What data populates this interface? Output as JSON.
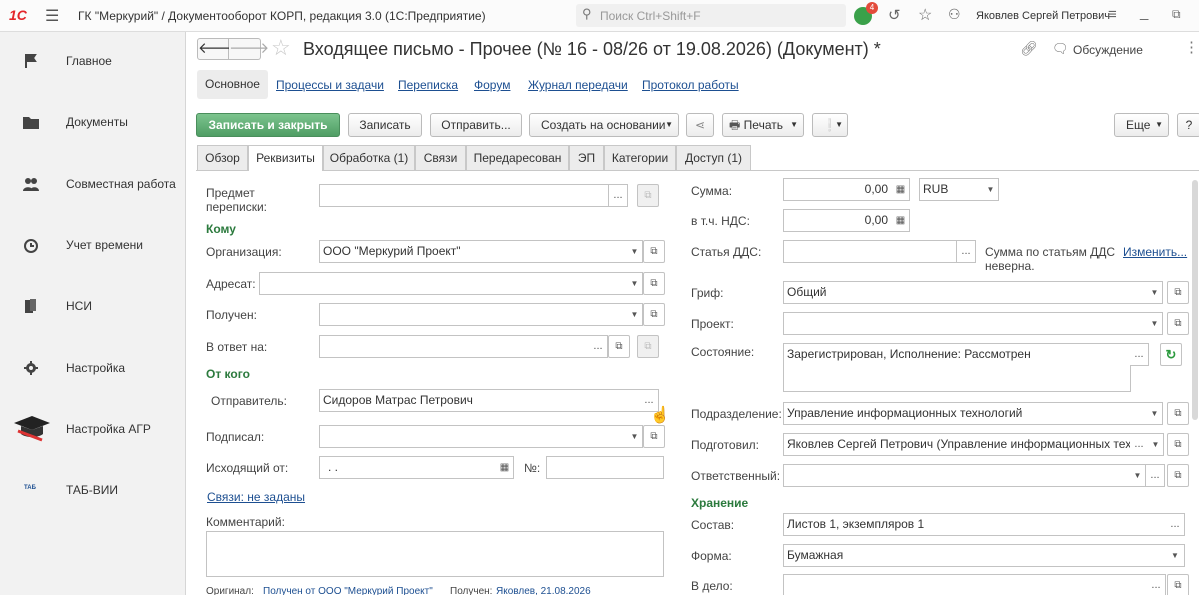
{
  "app": {
    "title": "ГК \"Меркурий\" / Документооборот КОРП, редакция 3.0  (1С:Предприятие)",
    "search_placeholder": "Поиск Ctrl+Shift+F",
    "notif_count": "4",
    "user": "Яковлев Сергей Петрович"
  },
  "sidebar": {
    "items": [
      {
        "label": "Главное",
        "icon": "flag-icon"
      },
      {
        "label": "Документы",
        "icon": "folder-icon"
      },
      {
        "label": "Совместная работа",
        "icon": "people-icon"
      },
      {
        "label": "Учет времени",
        "icon": "clock-icon"
      },
      {
        "label": "НСИ",
        "icon": "book-icon"
      },
      {
        "label": "Настройка",
        "icon": "gear-icon"
      },
      {
        "label": "Настройка АГР",
        "icon": "graduation-cap-icon"
      },
      {
        "label": "ТАБ-ВИИ",
        "icon": "tab-logo-icon",
        "logo_text": "ТАБ"
      }
    ]
  },
  "doc": {
    "title": "Входящее письмо - Прочее (№ 16 - 08/26 от 19.08.2026) (Документ) *",
    "discussion": "Обсуждение"
  },
  "nav": {
    "main": "Основное",
    "links": [
      "Процессы и задачи",
      "Переписка",
      "Форум",
      "Журнал передачи",
      "Протокол работы"
    ]
  },
  "toolbar": {
    "save_close": "Записать и закрыть",
    "save": "Записать",
    "send": "Отправить...",
    "create_basis": "Создать на основании",
    "print": "Печать",
    "more": "Еще",
    "help": "?"
  },
  "tabs": [
    "Обзор",
    "Реквизиты",
    "Обработка (1)",
    "Связи",
    "Передаресован",
    "ЭП",
    "Категории",
    "Доступ (1)"
  ],
  "left": {
    "subject_label1": "Предмет",
    "subject_label2": "переписки:",
    "subject_value": "",
    "to_group": "Кому",
    "org_label": "Организация:",
    "org_value": "ООО \"Меркурий Проект\"",
    "addressee_label": "Адресат:",
    "addressee_value": "",
    "received_label": "Получен:",
    "received_value": "",
    "reply_label": "В ответ на:",
    "reply_value": "",
    "from_group": "От кого",
    "sender_label": "Отправитель:",
    "sender_value": "Сидоров Матрас Петрович",
    "signed_label": "Подписал:",
    "signed_value": "",
    "outgoing_label": "Исходящий от:",
    "outgoing_value": "  .  .",
    "number_label": "№:",
    "number_value": "",
    "links_text": "Связи: не заданы",
    "comment_label": "Комментарий:",
    "comment_value": "",
    "original_label": "Оригинал:",
    "original_value": "Получен от ООО \"Меркурий Проект\"",
    "received_by_label": "Получен:",
    "received_by_value": "Яковлев, 21.08.2026"
  },
  "right": {
    "sum_label": "Сумма:",
    "sum_value": "0,00",
    "currency": "RUB",
    "vat_label": "в т.ч. НДС:",
    "vat_value": "0,00",
    "dds_label": "Статья ДДС:",
    "dds_value": "",
    "dds_note1": "Сумма по статьям ДДС",
    "dds_note2": "неверна.",
    "dds_change": "Изменить...",
    "grif_label": "Гриф:",
    "grif_value": "Общий",
    "project_label": "Проект:",
    "project_value": "",
    "state_label": "Состояние:",
    "state_value": "Зарегистрирован, Исполнение: Рассмотрен",
    "dept_label": "Подразделение:",
    "dept_value": "Управление информационных технологий",
    "prepared_label": "Подготовил:",
    "prepared_value": "Яковлев Сергей Петрович (Управление информационных техно",
    "resp_label": "Ответственный:",
    "resp_value": "",
    "storage_group": "Хранение",
    "comp_label": "Состав:",
    "comp_value": "Листов 1, экземпляров 1",
    "form_label": "Форма:",
    "form_value": "Бумажная",
    "case_label": "В дело:",
    "case_value": ""
  }
}
